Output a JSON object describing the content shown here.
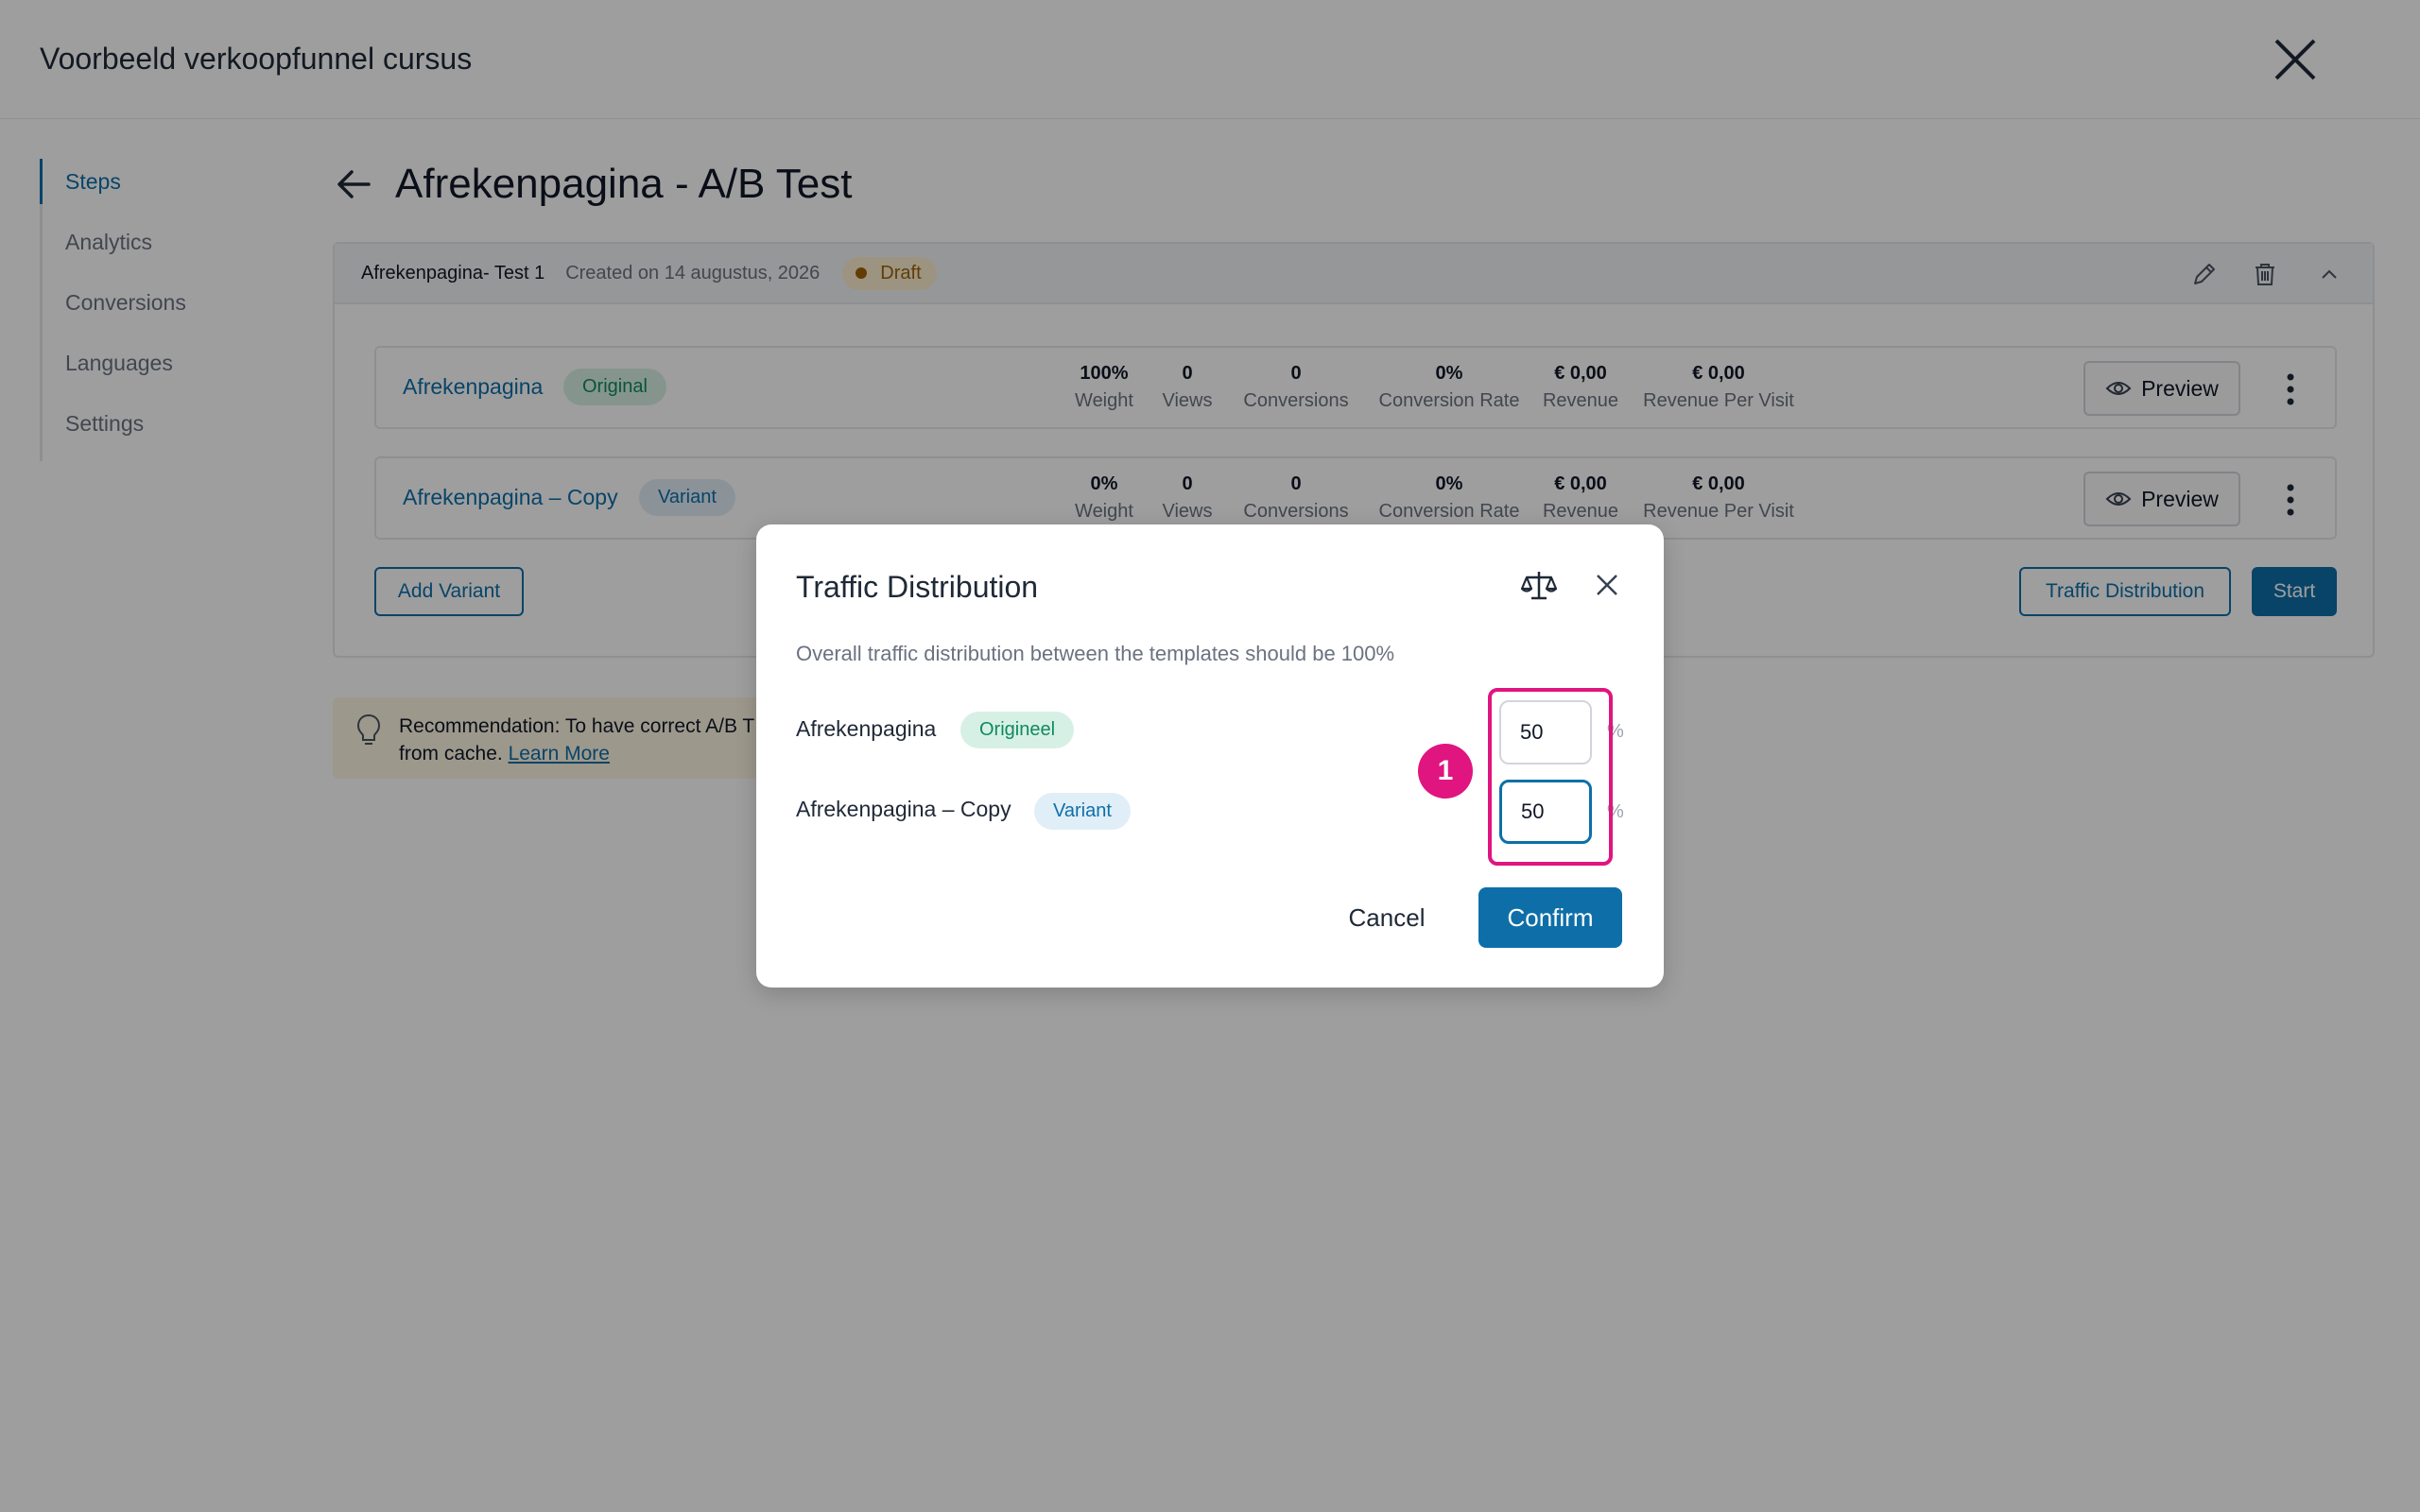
{
  "app": {
    "title": "Voorbeeld verkoopfunnel cursus"
  },
  "sidebar": {
    "items": [
      {
        "label": "Steps",
        "active": true
      },
      {
        "label": "Analytics"
      },
      {
        "label": "Conversions"
      },
      {
        "label": "Languages"
      },
      {
        "label": "Settings"
      }
    ]
  },
  "page": {
    "title": "Afrekenpagina - A/B Test"
  },
  "test": {
    "name": "Afrekenpagina- Test 1",
    "created": "Created on 14 augustus, 2026",
    "status": "Draft"
  },
  "variants": [
    {
      "name": "Afrekenpagina",
      "badge": "Original",
      "stats": [
        {
          "value": "100%",
          "label": "Weight"
        },
        {
          "value": "0",
          "label": "Views"
        },
        {
          "value": "0",
          "label": "Conversions"
        },
        {
          "value": "0%",
          "label": "Conversion Rate"
        },
        {
          "value": "€ 0,00",
          "label": "Revenue"
        },
        {
          "value": "€ 0,00",
          "label": "Revenue Per Visit"
        }
      ],
      "preview_label": "Preview"
    },
    {
      "name": "Afrekenpagina – Copy",
      "badge": "Variant",
      "stats": [
        {
          "value": "0%",
          "label": "Weight"
        },
        {
          "value": "0",
          "label": "Views"
        },
        {
          "value": "0",
          "label": "Conversions"
        },
        {
          "value": "0%",
          "label": "Conversion Rate"
        },
        {
          "value": "€ 0,00",
          "label": "Revenue"
        },
        {
          "value": "€ 0,00",
          "label": "Revenue Per Visit"
        }
      ],
      "preview_label": "Preview"
    }
  ],
  "actions": {
    "add_variant": "Add Variant",
    "traffic_distribution": "Traffic Distribution",
    "start": "Start"
  },
  "recommendation": {
    "text_line1": "Recommendation: To have correct A/B T",
    "text_line2": "from cache.",
    "link": "Learn More"
  },
  "modal": {
    "title": "Traffic Distribution",
    "description": "Overall traffic distribution between the templates should be 100%",
    "rows": [
      {
        "name": "Afrekenpagina",
        "badge": "Origineel",
        "value": "50",
        "unit": "%"
      },
      {
        "name": "Afrekenpagina – Copy",
        "badge": "Variant",
        "value": "50",
        "unit": "%"
      }
    ],
    "step_marker": "1",
    "cancel": "Cancel",
    "confirm": "Confirm"
  },
  "colors": {
    "accent": "#0e6fa8",
    "highlight": "#e0157f",
    "draft": "#a16207",
    "original_badge": "#0f8a5f"
  },
  "icons": [
    "close-icon",
    "back-arrow-icon",
    "pencil-icon",
    "trash-icon",
    "chevron-up-icon",
    "eye-icon",
    "kebab-icon",
    "lightbulb-icon",
    "scale-icon"
  ]
}
